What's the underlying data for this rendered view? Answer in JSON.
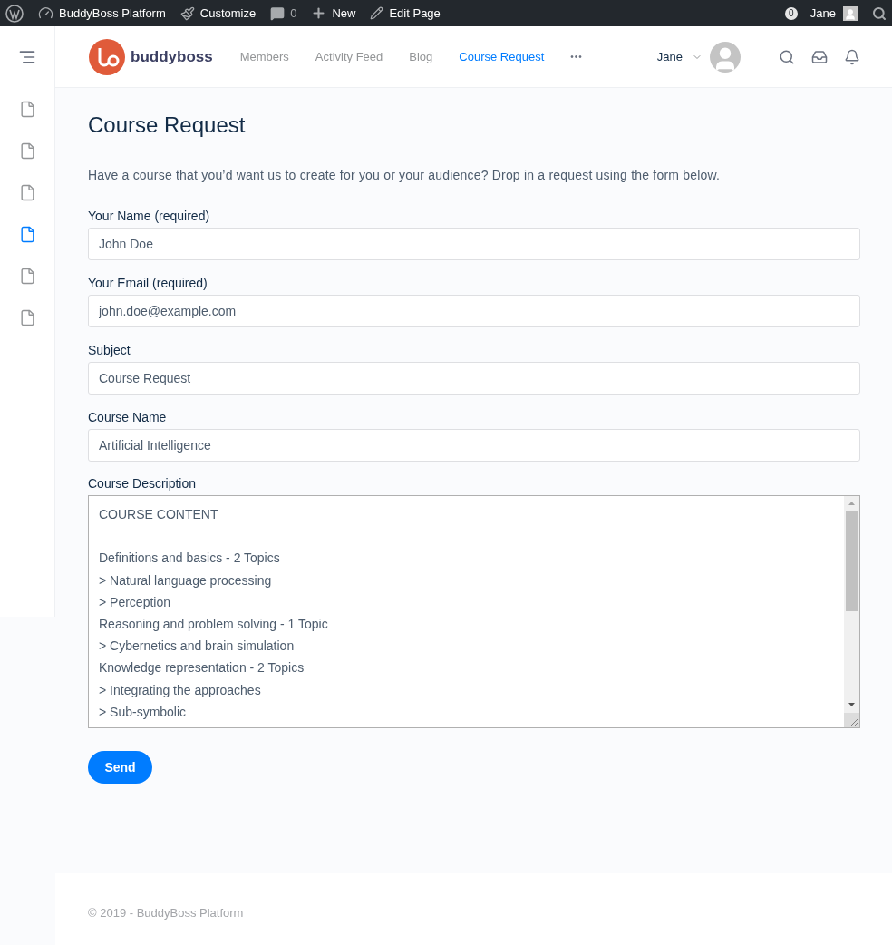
{
  "admin_bar": {
    "items": [
      {
        "kind": "logo"
      },
      {
        "kind": "dashboard",
        "label": "BuddyBoss Platform"
      },
      {
        "kind": "brush",
        "label": "Customize"
      },
      {
        "kind": "comment",
        "label": "0"
      },
      {
        "kind": "plus",
        "label": "New"
      },
      {
        "kind": "pencil",
        "label": "Edit Page"
      }
    ],
    "notifications": "0",
    "user": "Jane"
  },
  "sidebar": {
    "items": [
      {
        "selected": false
      },
      {
        "selected": false
      },
      {
        "selected": false
      },
      {
        "selected": true
      },
      {
        "selected": false
      },
      {
        "selected": false
      }
    ]
  },
  "header": {
    "logo_text": "buddyboss",
    "nav": [
      {
        "label": "Members",
        "selected": false
      },
      {
        "label": "Activity Feed",
        "selected": false
      },
      {
        "label": "Blog",
        "selected": false
      },
      {
        "label": "Course Request",
        "selected": true
      }
    ],
    "more": "•••",
    "user": "Jane"
  },
  "page": {
    "title": "Course Request",
    "intro": "Have a course that you’d want us to create for you or your audience? Drop in a request using the form below.",
    "fields": [
      {
        "label": "Your Name (required)",
        "value": "John Doe"
      },
      {
        "label": "Your Email (required)",
        "value": "john.doe@example.com"
      },
      {
        "label": "Subject",
        "value": "Course Request"
      },
      {
        "label": "Course Name",
        "value": "Artificial Intelligence"
      }
    ],
    "description": {
      "label": "Course Description",
      "lines": [
        "COURSE CONTENT",
        "Definitions and basics - 2 Topics",
        "> Natural language processing",
        "> Perception",
        "Reasoning and problem solving - 1 Topic",
        "> Cybernetics and brain simulation",
        "Knowledge representation - 2 Topics",
        "> Integrating the approaches",
        "> Sub-symbolic"
      ]
    },
    "submit": "Send"
  },
  "footer": {
    "text": "© 2019 - BuddyBoss Platform"
  }
}
